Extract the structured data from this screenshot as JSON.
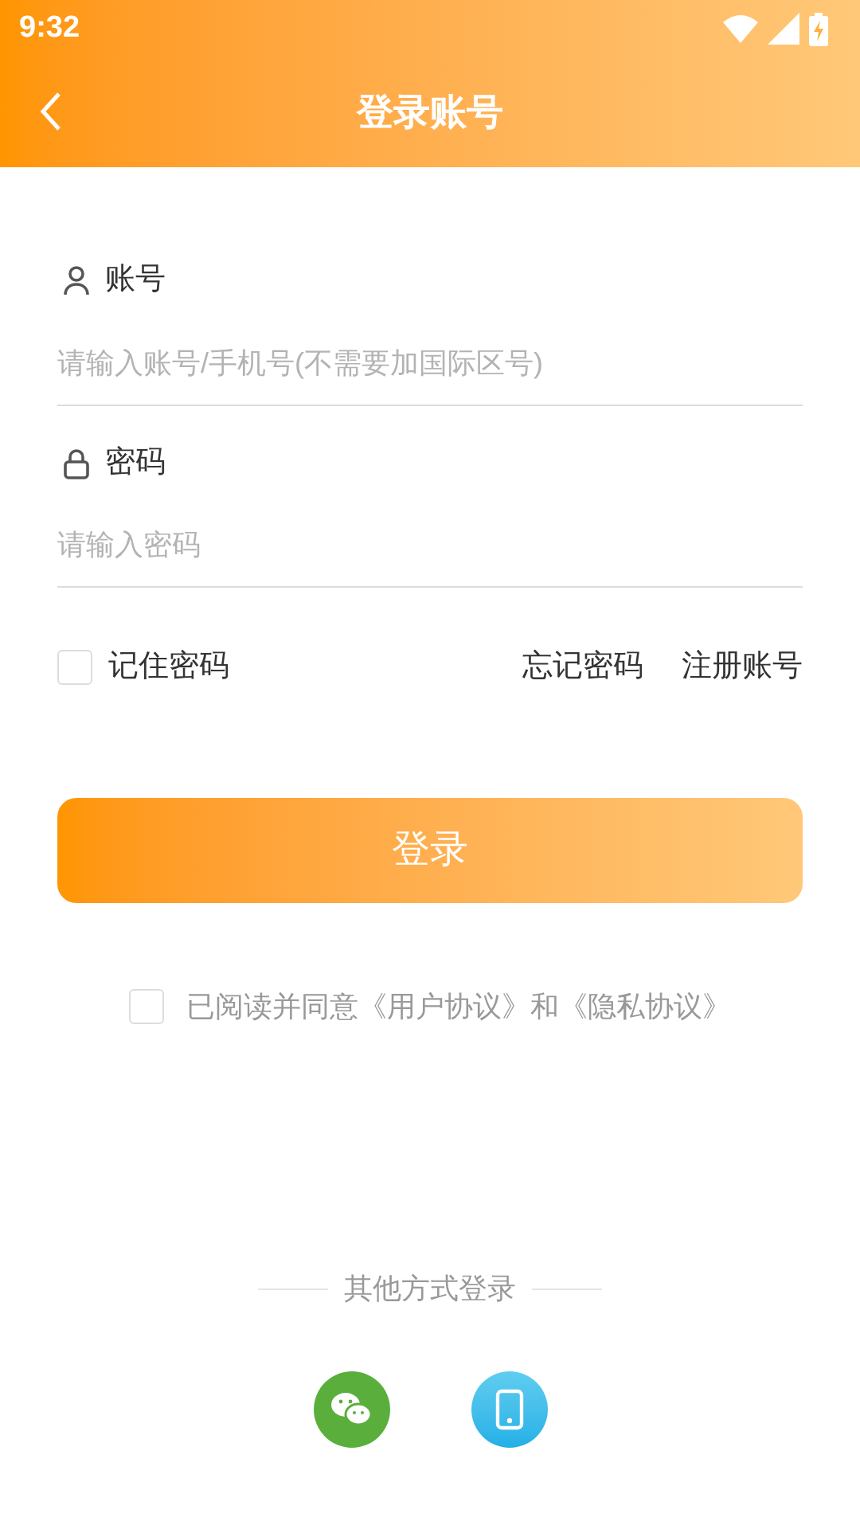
{
  "status_bar": {
    "time": "9:32"
  },
  "nav": {
    "title": "登录账号"
  },
  "fields": [
    {
      "kind": "account",
      "label": "账号",
      "placeholder": "请输入账号/手机号(不需要加国际区号)"
    },
    {
      "kind": "password",
      "label": "密码",
      "placeholder": "请输入密码"
    }
  ],
  "remember": {
    "label": "记住密码",
    "checked": false
  },
  "links": [
    "忘记密码",
    "注册账号"
  ],
  "login_button": "登录",
  "agreement": {
    "text": "已阅读并同意《用户协议》和《隐私协议》",
    "checked": false
  },
  "other_login": {
    "title": "其他方式登录",
    "methods": [
      {
        "kind": "wechat"
      },
      {
        "kind": "phone"
      }
    ]
  }
}
